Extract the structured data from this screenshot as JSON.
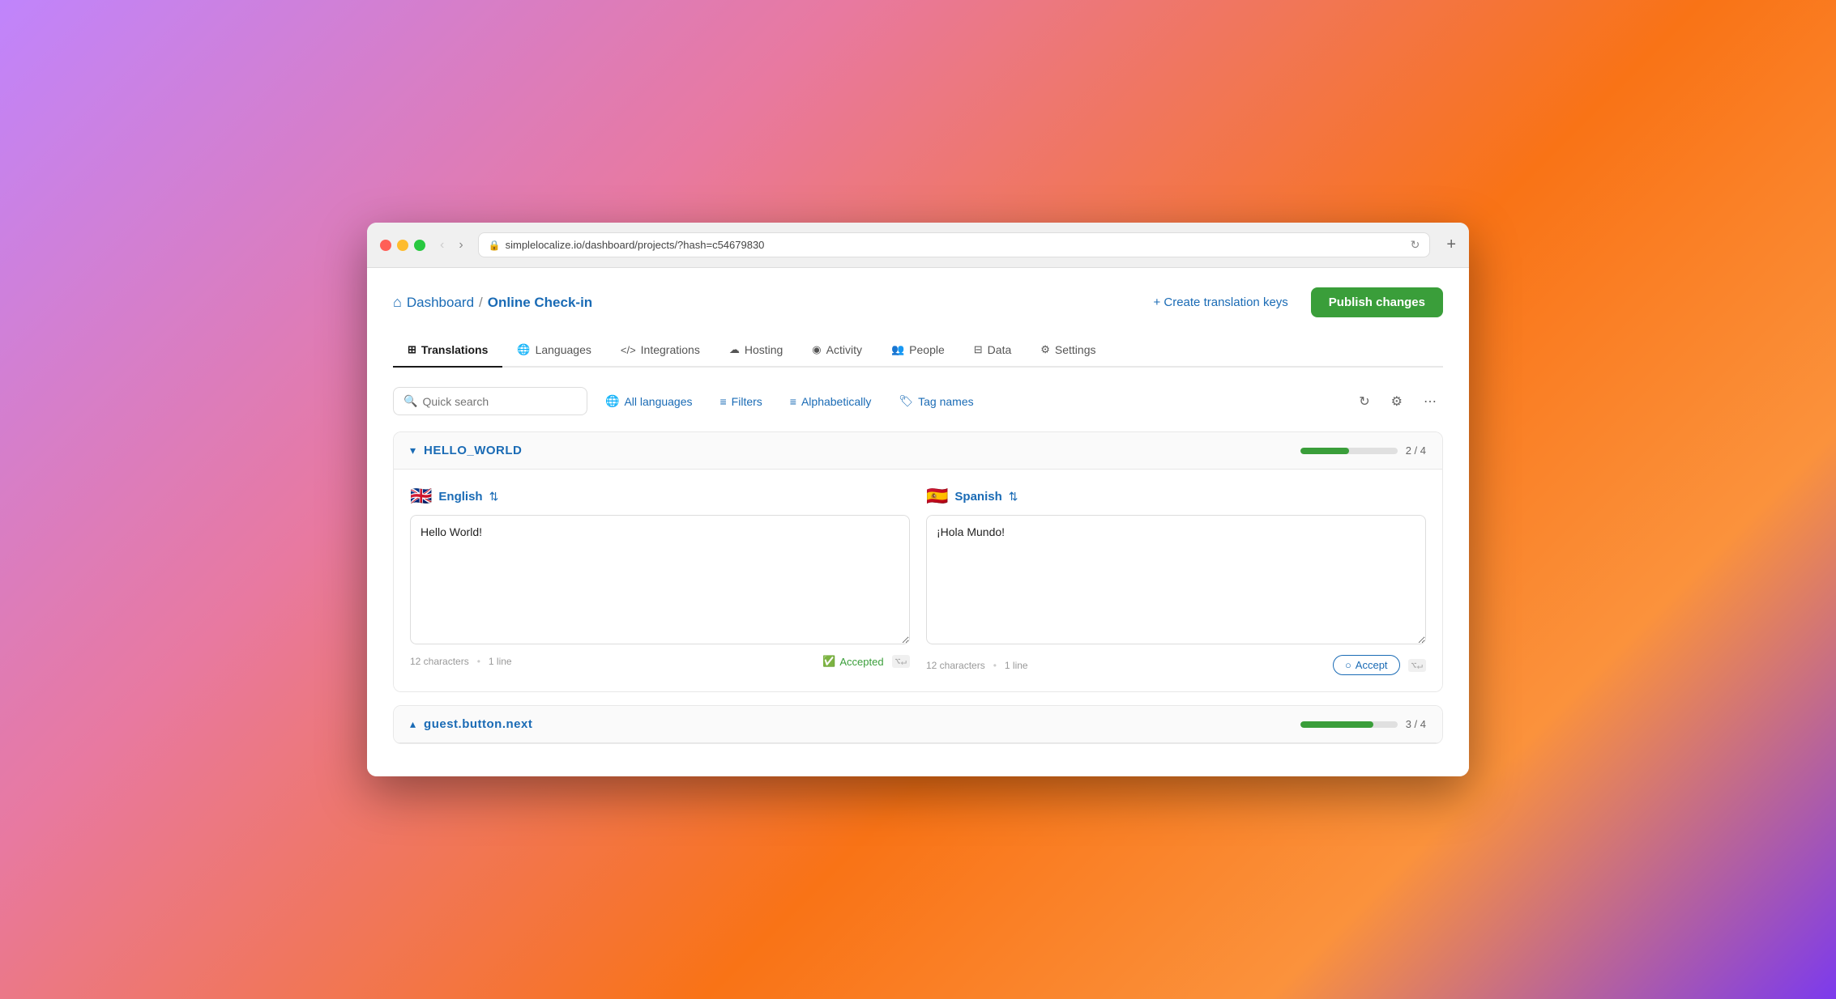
{
  "browser": {
    "url": "simplelocalize.io/dashboard/projects/?hash=c54679830",
    "reload_title": "Reload"
  },
  "breadcrumb": {
    "home_icon": "⌂",
    "dashboard": "Dashboard",
    "separator": "/",
    "project": "Online Check-in"
  },
  "header": {
    "create_keys_label": "+ Create translation keys",
    "publish_label": "Publish changes"
  },
  "nav_tabs": [
    {
      "id": "translations",
      "label": "Translations",
      "icon": "⊞",
      "active": true
    },
    {
      "id": "languages",
      "label": "Languages",
      "icon": "🌐"
    },
    {
      "id": "integrations",
      "label": "Integrations",
      "icon": "</>"
    },
    {
      "id": "hosting",
      "label": "Hosting",
      "icon": "☁"
    },
    {
      "id": "activity",
      "label": "Activity",
      "icon": "((•))"
    },
    {
      "id": "people",
      "label": "People",
      "icon": "👥"
    },
    {
      "id": "data",
      "label": "Data",
      "icon": "⊟"
    },
    {
      "id": "settings",
      "label": "Settings",
      "icon": "⚙"
    }
  ],
  "toolbar": {
    "search_placeholder": "Quick search",
    "all_languages_label": "All languages",
    "filters_label": "Filters",
    "alphabetically_label": "Alphabetically",
    "tag_names_label": "Tag names"
  },
  "groups": [
    {
      "key": "HELLO_WORLD",
      "expanded": true,
      "progress_value": 50,
      "progress_display": "2 / 4",
      "languages": [
        {
          "code": "en",
          "flag": "🇬🇧",
          "name": "English",
          "text": "Hello World!",
          "char_count": "12 characters",
          "line_count": "1 line",
          "status": "accepted",
          "status_label": "Accepted"
        },
        {
          "code": "es",
          "flag": "🇪🇸",
          "name": "Spanish",
          "text": "¡Hola Mundo!",
          "char_count": "12 characters",
          "line_count": "1 line",
          "status": "pending",
          "accept_label": "Accept"
        }
      ]
    },
    {
      "key": "guest.button.next",
      "expanded": false,
      "progress_value": 75,
      "progress_display": "3 / 4"
    }
  ]
}
